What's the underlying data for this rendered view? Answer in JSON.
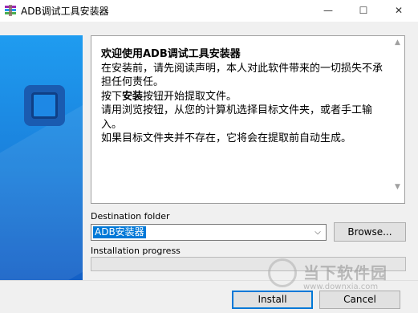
{
  "window": {
    "title": "ADB调试工具安装器",
    "minimize_label": "—",
    "maximize_label": "☐",
    "close_label": "✕"
  },
  "intro": {
    "headline": "欢迎使用ADB调试工具安装器",
    "line1": "在安装前，请先阅读声明，本人对此软件带来的一切损失不承担任何责任。",
    "line2_prefix": "按下",
    "line2_bold": "安装",
    "line2_suffix": "按钮开始提取文件。",
    "line3": "请用浏览按钮，从您的计算机选择目标文件夹，或者手工输入。",
    "line4": "如果目标文件夹并不存在，它将会在提取前自动生成。"
  },
  "destination": {
    "label": "Destination folder",
    "value": "ADB安装器",
    "browse_label": "Browse..."
  },
  "progress": {
    "label": "Installation progress",
    "value": 0
  },
  "buttons": {
    "install_label": "Install",
    "cancel_label": "Cancel"
  },
  "watermark": {
    "title": "当下软件园",
    "url": "www.downxia.com"
  },
  "colors": {
    "accent": "#0078d7",
    "sidebar": "#1a7fdb",
    "progress_fill": "#06b025"
  },
  "icons": {
    "app": "rar-installer-icon",
    "logo": "square-logo-icon",
    "dropdown": "chevron-down-icon"
  }
}
